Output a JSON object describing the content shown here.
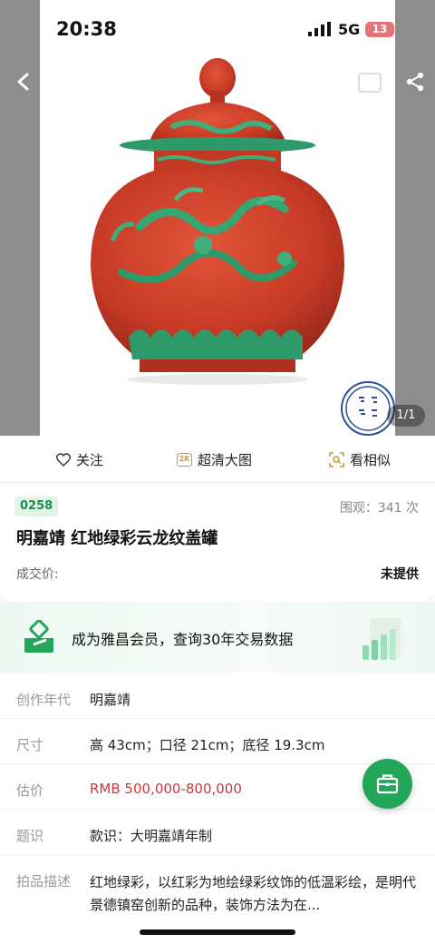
{
  "status": {
    "time": "20:38",
    "network": "5G",
    "battery": "13"
  },
  "gallery": {
    "counter": "1/1"
  },
  "actions": [
    {
      "label": "关注",
      "icon": "heart-icon"
    },
    {
      "label": "超清大图",
      "icon": "2k-icon",
      "badge": "2K"
    },
    {
      "label": "看相似",
      "icon": "scan-icon"
    }
  ],
  "lot": {
    "number": "0258",
    "views": "围观：341 次",
    "title": "明嘉靖 红地绿彩云龙纹盖罐",
    "price_label": "成交价:",
    "price_value": "未提供"
  },
  "member": {
    "text": "成为雅昌会员，查询30年交易数据"
  },
  "details": [
    {
      "label": "创作年代",
      "value": "明嘉靖"
    },
    {
      "label": "尺寸",
      "value": "高 43cm；口径 21cm；底径 19.3cm"
    },
    {
      "label": "估价",
      "value": "RMB  500,000-800,000"
    },
    {
      "label": "题识",
      "value": "款识：大明嘉靖年制"
    },
    {
      "label": "拍品描述",
      "value": "红地绿彩，以红彩为地绘绿彩纹饰的低温彩绘，是明代景德镇窑创新的品种，装饰方法为在..."
    }
  ],
  "colors": {
    "accent": "#23a55a",
    "estimate_red": "#c8383e",
    "lot_tag_bg": "#e2f4ea"
  }
}
